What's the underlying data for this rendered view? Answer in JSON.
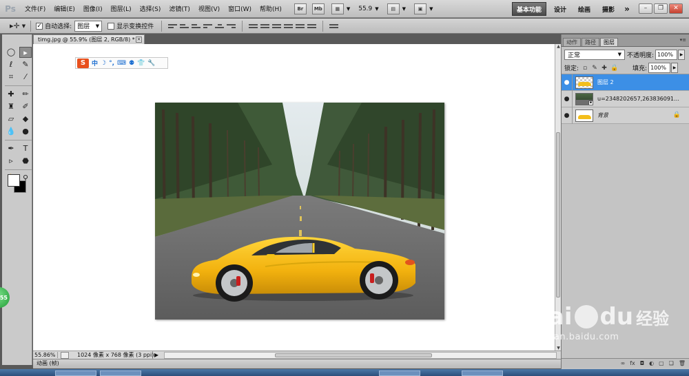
{
  "app": {
    "logo": "Ps"
  },
  "menus": [
    "文件(F)",
    "编辑(E)",
    "图像(I)",
    "图层(L)",
    "选择(S)",
    "滤镜(T)",
    "视图(V)",
    "窗口(W)",
    "帮助(H)"
  ],
  "menubar_icons": [
    "Br",
    "Mb"
  ],
  "zoom_value": "55.9",
  "workspaces": [
    "基本功能",
    "设计",
    "绘画",
    "摄影"
  ],
  "workspace_more": "»",
  "window_buttons": [
    "–",
    "❐",
    "✕"
  ],
  "options": {
    "auto_select_label": "自动选择:",
    "auto_select_value": "图层",
    "show_transform_label": "显示变换控件"
  },
  "document": {
    "tab_title": "timg.jpg @ 55.9% (图层 2, RGB/8) *",
    "tab_close": "×"
  },
  "ime": {
    "logo": "S",
    "mode": "中",
    "icons": [
      "☽",
      "°,",
      "⌨",
      "⚉",
      "👕",
      "🔧"
    ]
  },
  "status": {
    "zoom": "55.86%",
    "doc_info": "1024 像素 x 768 像素 (3 ppi)"
  },
  "animation_tab": "动画 (帧)",
  "panel": {
    "tabs": [
      "动作",
      "路径",
      "图层"
    ],
    "active_tab": 2,
    "blend_mode": "正常",
    "opacity_label": "不透明度:",
    "opacity_value": "100%",
    "lock_label": "锁定:",
    "fill_label": "填充:",
    "fill_value": "100%",
    "layers": [
      {
        "name": "图层 2",
        "active": true
      },
      {
        "name": "u=2348202657,2638360918&...",
        "active": false
      },
      {
        "name": "背景",
        "active": false
      }
    ],
    "bottom_icons": [
      "∞",
      "fx",
      "◘",
      "◐",
      "▢",
      "❏",
      "🗑"
    ]
  },
  "badge_text": "55",
  "watermark": {
    "brand": "Bai",
    "brand2": "du",
    "cn": "经验",
    "url": "jingyan.baidu.com"
  }
}
